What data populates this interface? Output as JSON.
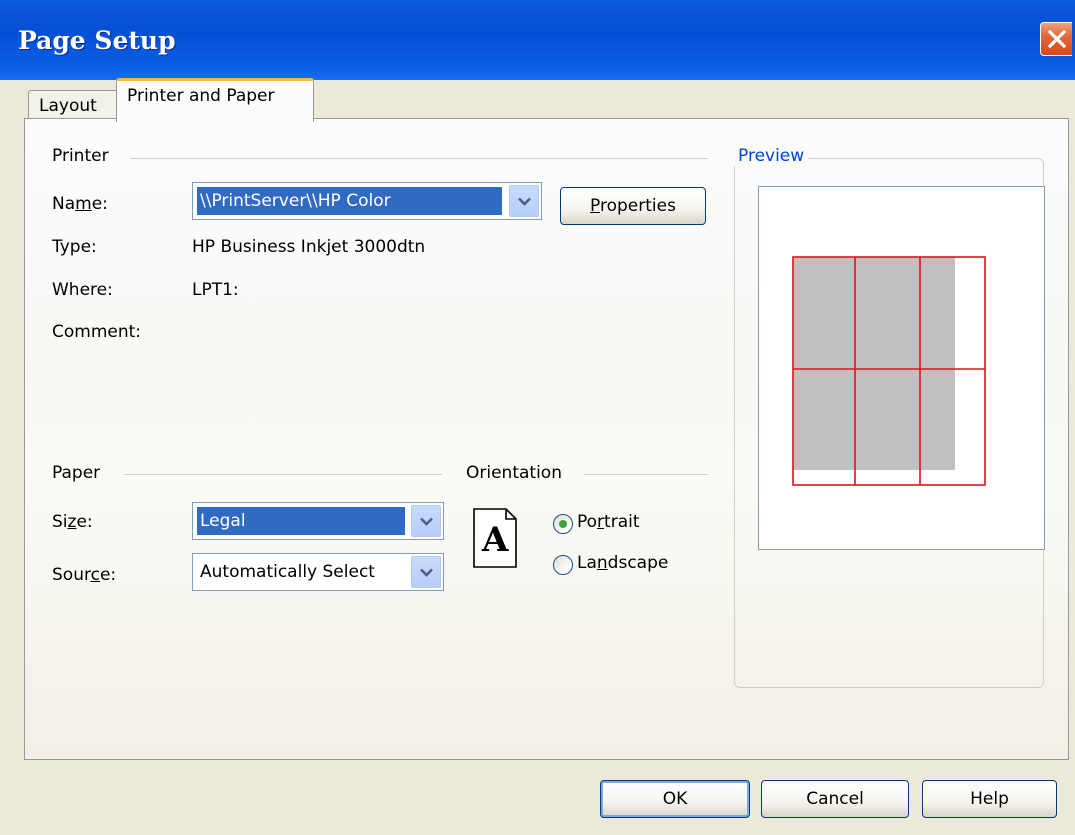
{
  "window": {
    "title": "Page Setup"
  },
  "tabs": [
    {
      "label": "Layout",
      "active": false
    },
    {
      "label": "Printer and Paper",
      "active": true
    }
  ],
  "printer": {
    "group_label": "Printer",
    "name_label_pre": "Na",
    "name_label_key": "m",
    "name_label_post": "e:",
    "name_value": "\\\\PrintServer\\\\HP Color",
    "type_label": "Type:",
    "type_value": "HP Business Inkjet 3000dtn",
    "where_label": "Where:",
    "where_value": "LPT1:",
    "comment_label": "Comment:",
    "properties_pre": "",
    "properties_key": "P",
    "properties_post": "roperties"
  },
  "paper": {
    "group_label": "Paper",
    "size_label_pre": "Si",
    "size_label_key": "z",
    "size_label_post": "e:",
    "size_value": "Legal",
    "source_label_pre": "Sour",
    "source_label_key": "c",
    "source_label_post": "e:",
    "source_value": "Automatically Select"
  },
  "orientation": {
    "group_label": "Orientation",
    "icon_letter": "A",
    "portrait_pre": "Po",
    "portrait_key": "r",
    "portrait_post": "trait",
    "landscape_pre": "La",
    "landscape_key": "n",
    "landscape_post": "dscape",
    "selected": "portrait"
  },
  "preview": {
    "label": "Preview",
    "grid_color": "#e0101a",
    "shade_color": "#c0c0c0"
  },
  "footer": {
    "ok_label": "OK",
    "cancel_label": "Cancel",
    "help_label": "Help"
  },
  "colors": {
    "title_blue": "#0350d4",
    "selection_blue": "#316ac5",
    "tab_accent": "#f7b64a",
    "radio_dot": "#3fa43f",
    "close_red": "#d64a1c"
  }
}
